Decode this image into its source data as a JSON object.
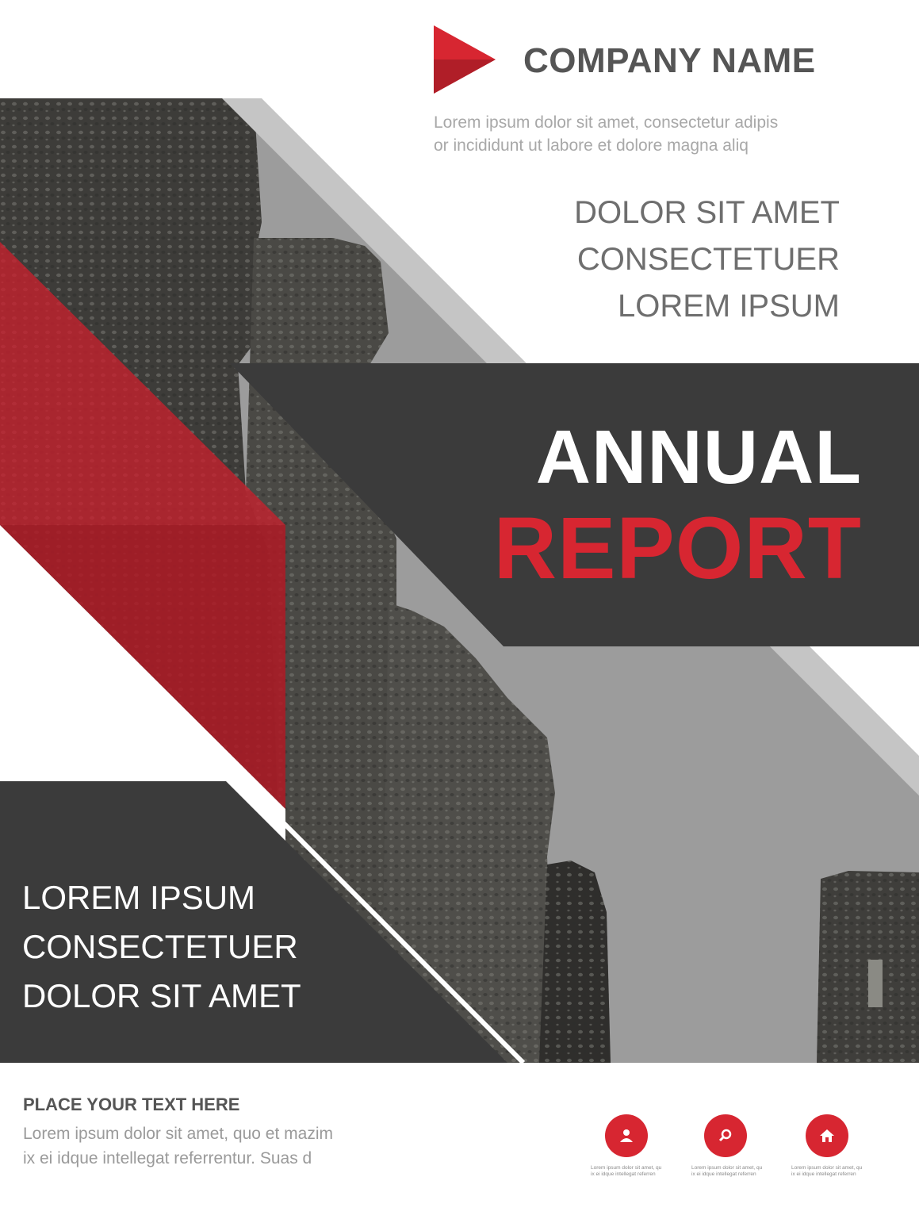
{
  "colors": {
    "accent": "#d72631",
    "dark_panel": "#3b3b3b",
    "sky": "#9a9a9a",
    "text_gray": "#555555"
  },
  "logo": {
    "icon": "play-triangle-icon"
  },
  "company_name": "COMPANY NAME",
  "tagline": [
    "Lorem ipsum dolor sit amet, consectetur adipis",
    "or incididunt ut labore et dolore magna aliq"
  ],
  "subheadline": [
    "DOLOR SIT AMET",
    "CONSECTETUER",
    "LOREM IPSUM"
  ],
  "title": {
    "line1": "ANNUAL",
    "line2": "REPORT"
  },
  "lower_panel": [
    "LOREM IPSUM",
    "CONSECTETUER",
    "DOLOR SIT AMET"
  ],
  "footer": {
    "heading": "PLACE YOUR TEXT HERE",
    "body": [
      "Lorem ipsum dolor sit amet, quo et mazim",
      " ix ei idque intellegat referrentur. Suas d"
    ]
  },
  "icons": [
    {
      "icon": "user-icon",
      "caption": [
        "Lorem ipsum dolor sit amet, qu",
        "ix ei idque intellegat referren"
      ]
    },
    {
      "icon": "search-icon",
      "caption": [
        "Lorem ipsum dolor sit amet, qu",
        "ix ei idque intellegat referren"
      ]
    },
    {
      "icon": "home-icon",
      "caption": [
        "Lorem ipsum dolor sit amet, qu",
        "ix ei idque intellegat referren"
      ]
    }
  ]
}
